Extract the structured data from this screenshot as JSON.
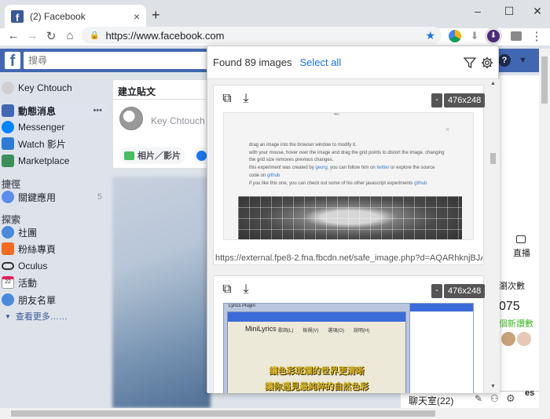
{
  "browser": {
    "tab_title": "(2) Facebook",
    "tab_close": "×",
    "new_tab": "+",
    "url": "https://www.facebook.com",
    "win_min": "–",
    "win_max": "☐",
    "win_close": "✕"
  },
  "fb": {
    "search_placeholder": "搜尋",
    "nav": [
      {
        "label": "Key Chtouch"
      },
      {
        "label": "動態消息"
      },
      {
        "label": "Messenger"
      },
      {
        "label": "Watch 影片"
      },
      {
        "label": "Marketplace"
      },
      {
        "label": "關鍵應用",
        "count": "5"
      },
      {
        "label": "社團"
      },
      {
        "label": "粉絲專頁"
      },
      {
        "label": "Oculus"
      },
      {
        "label": "活動"
      },
      {
        "label": "朋友名單"
      },
      {
        "label": "查看更多……"
      }
    ],
    "section_shortcuts": "捷徑",
    "section_explore": "探索",
    "more_dots": "•••",
    "composer": {
      "title": "建立貼文",
      "placeholder": "Key Chtouch，",
      "photo_button": "相片／影片"
    },
    "right": {
      "live": "直播",
      "views": "瀏次數",
      "count": "075",
      "new_reviews": "個新讚數",
      "chat_label": "聊天室(22)",
      "es": "es"
    }
  },
  "popup": {
    "found_text": "Found 89 images",
    "select_all": "Select all",
    "cards": [
      {
        "dash": "-",
        "size": "476x248",
        "url": "https://external.fpe8-2.fna.fbcdn.net/safe_image.php?d=AQARhknjBJA-o0DI",
        "preview": {
          "tick": "40",
          "line1": "drag an image into the browser window to modify it.",
          "line2": "with your mouse, hover over the image and drag the grid points to distort the image. changing",
          "line3": "the grid size removes previous changes.",
          "line4_a": "this experiment was created by ",
          "line4_link1": "georg",
          "line4_b": ", you can follow him on ",
          "line4_link2": "twitter",
          "line4_c": " or explore the source",
          "line5_a": "code on ",
          "line5_link": "github",
          "line6_a": "if you like this one, you can check out some of his other javascript experiments ",
          "line6_link": "github",
          "close": "×"
        }
      },
      {
        "dash": "-",
        "size": "476x248",
        "preview": {
          "window_title": "Lyrics Plugin",
          "app_title": "MiniLyrics",
          "menu": "歌詞(L)　　檢視(V)　　選項(O)　　說明(H)",
          "lyric1": "讓色彩斑斕的世界更清晰",
          "lyric2": "讓你遇見最純粹的自然色彩"
        }
      }
    ]
  }
}
